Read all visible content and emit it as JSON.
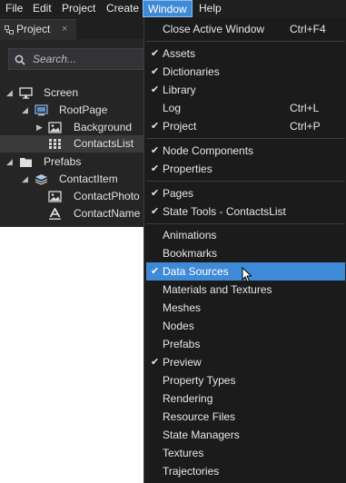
{
  "menubar": {
    "items": [
      {
        "label": "File"
      },
      {
        "label": "Edit"
      },
      {
        "label": "Project"
      },
      {
        "label": "Create"
      },
      {
        "label": "Window",
        "active": true
      },
      {
        "label": "Help"
      }
    ]
  },
  "panel": {
    "tab_label": "Project",
    "tab_close": "×",
    "search_placeholder": "Search...",
    "tree": [
      {
        "label": "Screen",
        "icon": "monitor-icon",
        "expanded": true
      },
      {
        "label": "RootPage",
        "icon": "page-icon",
        "expanded": true
      },
      {
        "label": "Background",
        "icon": "image-icon",
        "expanded": false
      },
      {
        "label": "ContactsList",
        "icon": "grid-list-icon",
        "selected": true
      },
      {
        "label": "Prefabs",
        "icon": "folder-icon",
        "expanded": true
      },
      {
        "label": "ContactItem",
        "icon": "layers-icon",
        "expanded": true
      },
      {
        "label": "ContactPhoto",
        "icon": "image-icon"
      },
      {
        "label": "ContactName",
        "icon": "text-icon"
      }
    ]
  },
  "window_menu": {
    "groups": [
      [
        {
          "label": "Close Active Window",
          "shortcut": "Ctrl+F4",
          "checked": false
        }
      ],
      [
        {
          "label": "Assets",
          "checked": true
        },
        {
          "label": "Dictionaries",
          "checked": true
        },
        {
          "label": "Library",
          "checked": true
        },
        {
          "label": "Log",
          "shortcut": "Ctrl+L",
          "checked": false
        },
        {
          "label": "Project",
          "shortcut": "Ctrl+P",
          "checked": true
        }
      ],
      [
        {
          "label": "Node Components",
          "checked": true
        },
        {
          "label": "Properties",
          "checked": true
        }
      ],
      [
        {
          "label": "Pages",
          "checked": true
        },
        {
          "label": "State Tools - ContactsList",
          "checked": true
        }
      ],
      [
        {
          "label": "Animations",
          "checked": false
        },
        {
          "label": "Bookmarks",
          "checked": false
        },
        {
          "label": "Data Sources",
          "checked": true,
          "highlighted": true
        },
        {
          "label": "Materials and Textures",
          "checked": false
        },
        {
          "label": "Meshes",
          "checked": false
        },
        {
          "label": "Nodes",
          "checked": false
        },
        {
          "label": "Prefabs",
          "checked": false
        },
        {
          "label": "Preview",
          "checked": true
        },
        {
          "label": "Property Types",
          "checked": false
        },
        {
          "label": "Rendering",
          "checked": false
        },
        {
          "label": "Resource Files",
          "checked": false
        },
        {
          "label": "State Managers",
          "checked": false
        },
        {
          "label": "Textures",
          "checked": false
        },
        {
          "label": "Trajectories",
          "checked": false
        }
      ]
    ]
  },
  "colors": {
    "menubar_bg": "#1f1f1f",
    "menu_bg": "#1b1b1c",
    "highlight": "#3f8ad6",
    "panel_bg": "#252526",
    "selection_bg": "#3a3a3d"
  }
}
